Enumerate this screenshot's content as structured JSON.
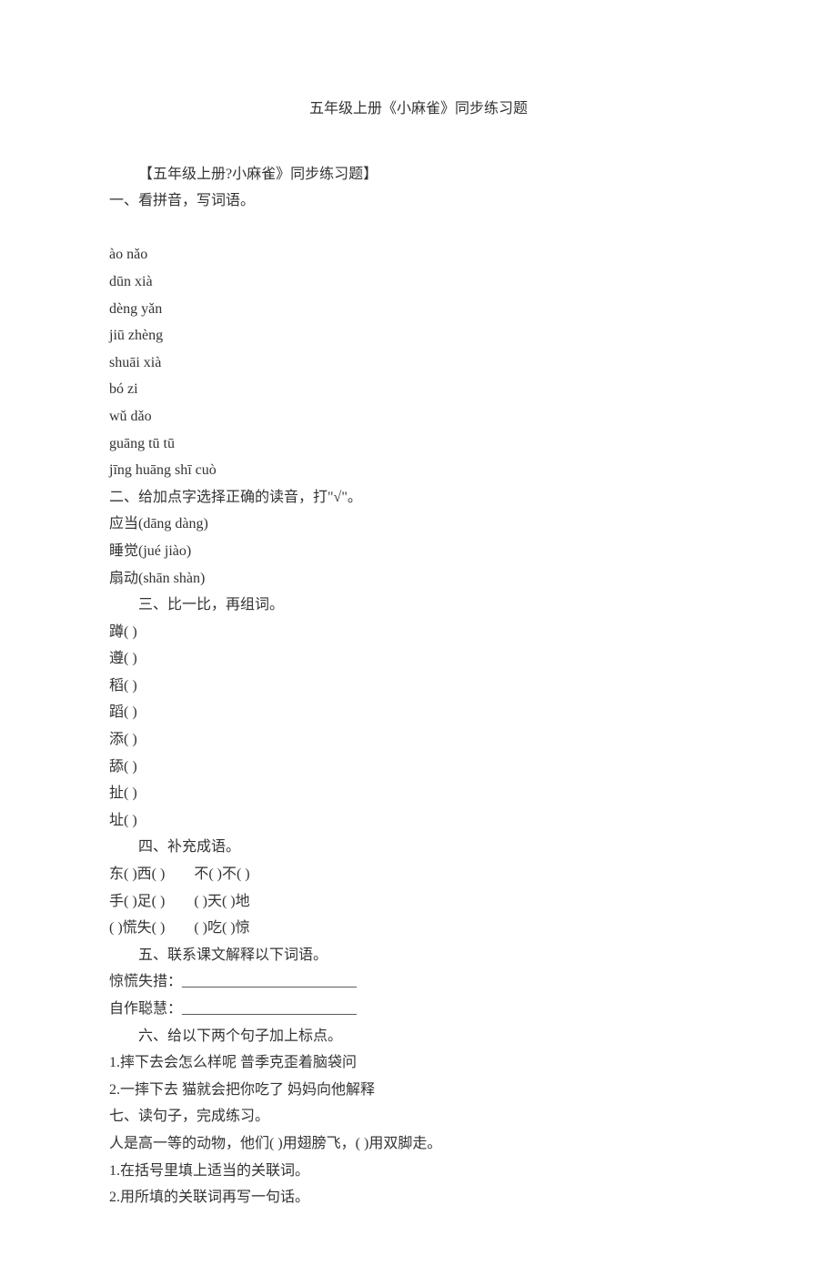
{
  "title": "五年级上册《小麻雀》同步练习题",
  "intro": "【五年级上册?小麻雀》同步练习题】",
  "s1": {
    "heading": "一、看拼音，写词语。",
    "items": [
      "ào nǎo",
      "dūn xià",
      "dèng yǎn",
      "jiū zhèng",
      "shuāi xià",
      "bó zi",
      "wǔ dǎo",
      "guāng tū tū",
      "jīng huāng shī cuò"
    ]
  },
  "s2": {
    "heading": "二、给加点字选择正确的读音，打\"√\"。",
    "items": [
      "应当(dāng dàng)",
      "睡觉(jué jiào)",
      "扇动(shān shàn)"
    ]
  },
  "s3": {
    "heading": "三、比一比，再组词。",
    "items": [
      "蹲( )",
      "遵( )",
      "稻( )",
      "蹈( )",
      "添( )",
      "舔( )",
      "扯( )",
      "址( )"
    ]
  },
  "s4": {
    "heading": "四、补充成语。",
    "lines": [
      "东( )西( )　　不( )不( )",
      "手( )足( )　　( )天( )地",
      "( )慌失( )　　( )吃( )惊"
    ]
  },
  "s5": {
    "heading": "五、联系课文解释以下词语。",
    "lines": [
      "惊慌失措：________________________",
      "自作聪慧：________________________"
    ]
  },
  "s6": {
    "heading": "六、给以下两个句子加上标点。",
    "lines": [
      "1.摔下去会怎么样呢  普季克歪着脑袋问",
      "2.一摔下去  猫就会把你吃了  妈妈向他解释"
    ]
  },
  "s7": {
    "heading": "七、读句子，完成练习。",
    "lines": [
      "人是高一等的动物，他们( )用翅膀飞，( )用双脚走。",
      "1.在括号里填上适当的关联词。",
      "2.用所填的关联词再写一句话。"
    ]
  }
}
